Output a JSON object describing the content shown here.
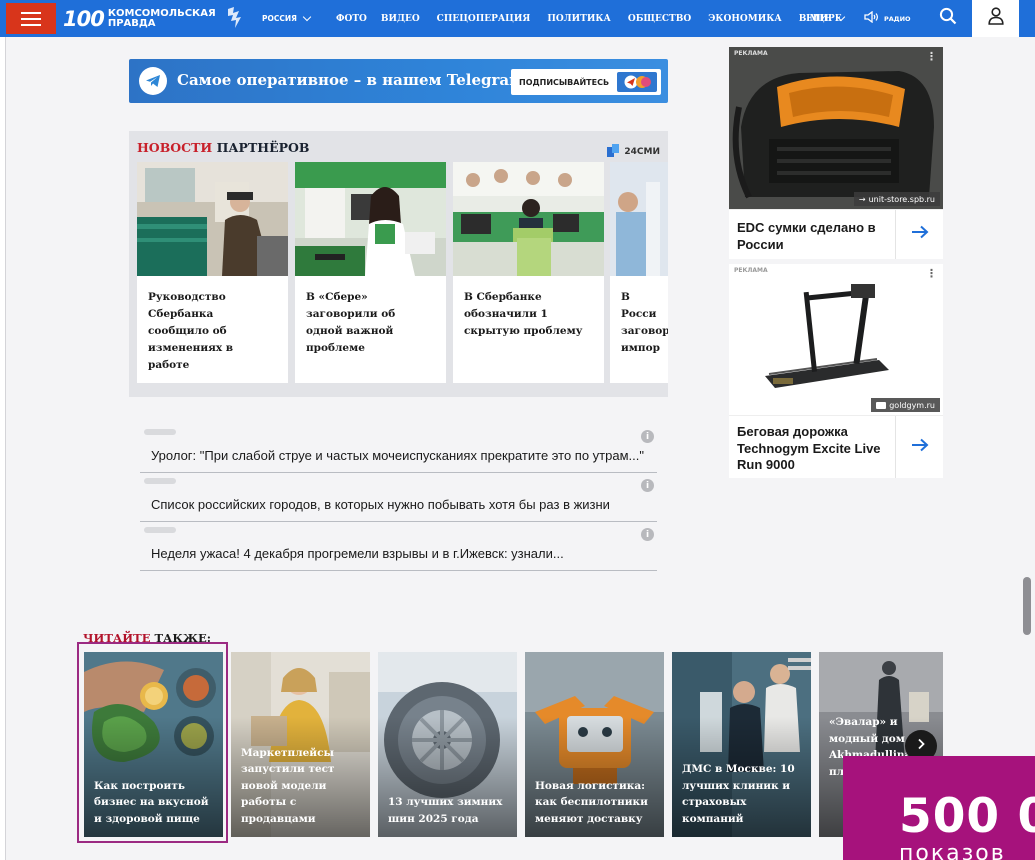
{
  "header": {
    "logo_number": "100",
    "logo_line1": "КОМСОМОЛЬСКАЯ",
    "logo_line2": "ПРАВДА",
    "region": "РОССИЯ",
    "nav": [
      "ФОТО",
      "ВИДЕО",
      "СПЕЦОПЕРАЦИЯ",
      "ПОЛИТИКА",
      "ОБЩЕСТВО",
      "ЭКОНОМИКА",
      "В МИРЕ"
    ],
    "more": "ЕЩЕ",
    "radio": "РАДИО",
    "accent": "#1f6fd9",
    "burger_color": "#d8351b"
  },
  "telegram": {
    "text": "Самое оперативное – в нашем Telegram",
    "button": "ПОДПИСЫВАЙТЕСЬ"
  },
  "partners": {
    "title_red": "НОВОСТИ",
    "title_rest": " ПАРТНЁРОВ",
    "source": "24СМИ",
    "cards": [
      {
        "text": "Руководство Сбербанка сообщило об изменениях в работе"
      },
      {
        "text": "В «Сбере» заговорили об одной важной проблеме"
      },
      {
        "text": "В Сбербанке обозначили 1 скрытую проблему"
      },
      {
        "text": "В Росси заговор импор"
      }
    ]
  },
  "links": [
    {
      "text": "Уролог: \"При слабой струе и частых мочеиспусканиях прекратите это по утрам...\""
    },
    {
      "text": "Список российских городов, в которых нужно побывать хотя бы раз в жизни"
    },
    {
      "text": "Неделя ужаса! 4 декабря прогремели взрывы и в г.Ижевск: узнали..."
    }
  ],
  "ads": [
    {
      "label": "РЕКЛАМА",
      "source": "unit-store.spb.ru",
      "caption": "EDC сумки сделано в России"
    },
    {
      "label": "РЕКЛАМА",
      "source": "goldgym.ru",
      "caption": "Беговая дорожка Technogym Excite Live Run 9000"
    }
  ],
  "read_also": {
    "title_red": "ЧИТАЙТЕ",
    "title_rest": " ТАКЖЕ:",
    "cards": [
      {
        "caption": "Как построить бизнес на вкусной и здоровой пище"
      },
      {
        "caption": "Маркетплейсы запустили тест новой модели работы с продавцами"
      },
      {
        "caption": "13 лучших зимних шин 2025 года"
      },
      {
        "caption": "Новая логистика: как беспилотники меняют доставку"
      },
      {
        "caption": "ДМС в Москве: 10 лучших клиник и страховых компаний"
      },
      {
        "caption": "«Эвалар» и модный дом Akhmadullina пр пл пе пл"
      }
    ]
  },
  "promo": {
    "big": "500 0",
    "small": "показов",
    "color": "#a6127c"
  }
}
